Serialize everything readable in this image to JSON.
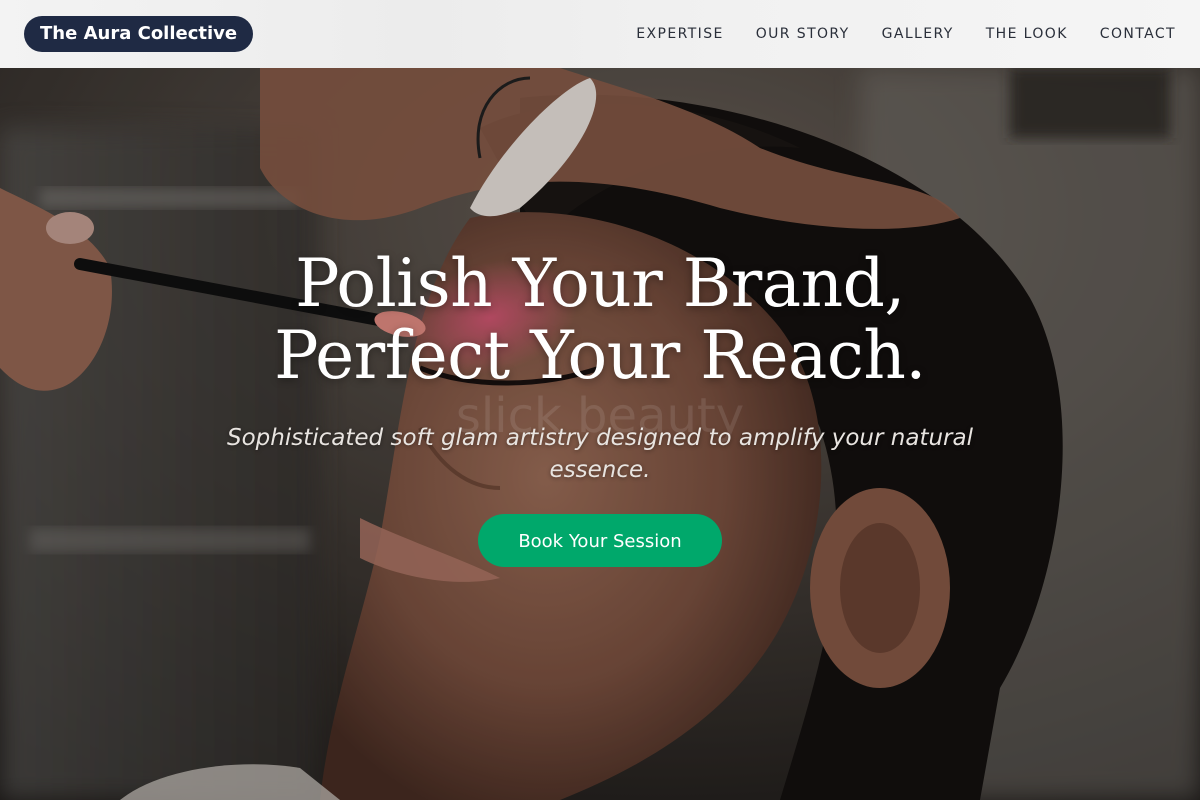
{
  "brand": {
    "name": "The Aura Collective"
  },
  "nav": {
    "items": [
      {
        "label": "EXPERTISE"
      },
      {
        "label": "OUR STORY"
      },
      {
        "label": "GALLERY"
      },
      {
        "label": "THE LOOK"
      },
      {
        "label": "CONTACT"
      }
    ]
  },
  "hero": {
    "title": "Polish Your Brand, Perfect Your Reach.",
    "watermark": "slick beauty",
    "subtitle": "Sophisticated soft glam artistry designed to amplify your natural essence.",
    "cta_label": "Book Your Session",
    "image_subject": "makeup artist applying eyeshadow to a woman's closed eye"
  },
  "colors": {
    "brand_pill": "#1f2a44",
    "cta": "#00a86b",
    "nav_text": "#2a2f3a"
  }
}
